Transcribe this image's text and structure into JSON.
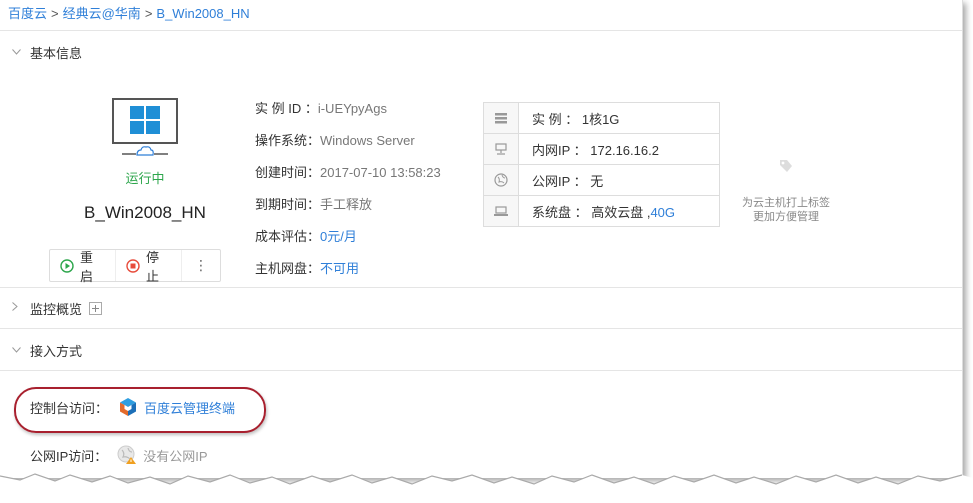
{
  "breadcrumb": {
    "items": [
      "百度云",
      "经典云@华南",
      "B_Win2008_HN"
    ],
    "separator": ">"
  },
  "sections": {
    "basic": "基本信息",
    "monitor": "监控概览",
    "access": "接入方式"
  },
  "instance": {
    "status": "运行中",
    "name": "B_Win2008_HN",
    "actions": {
      "restart": "重启",
      "stop": "停止",
      "more": "⋮"
    }
  },
  "info": [
    {
      "label": "实 例 ID ：",
      "value": "i-UEYpyAgs",
      "link": false
    },
    {
      "label": "操作系统：",
      "value": "Windows Server",
      "link": false
    },
    {
      "label": "创建时间：",
      "value": "2017-07-10 13:58:23",
      "link": false
    },
    {
      "label": "到期时间：",
      "value": "手工释放",
      "link": false
    },
    {
      "label": "成本评估：",
      "value": "0元/月",
      "link": true
    },
    {
      "label": "主机网盘：",
      "value": "不可用",
      "link": true
    }
  ],
  "specs": [
    {
      "icon": "server-icon",
      "text": "实 例 ： 1核1G",
      "extra": ""
    },
    {
      "icon": "lan-icon",
      "text": "内网IP ： 172.16.16.2",
      "extra": ""
    },
    {
      "icon": "globe-icon",
      "text": "公网IP ： 无",
      "extra": ""
    },
    {
      "icon": "disk-icon",
      "text": "系统盘 ： 高效云盘 ,",
      "extra": "40G"
    }
  ],
  "tag_tip": {
    "line1": "为云主机打上标签",
    "line2": "更加方便管理"
  },
  "access": {
    "console_label": "控制台访问：",
    "console_link": "百度云管理终端",
    "public_label": "公网IP访问：",
    "public_value": "没有公网IP"
  },
  "colors": {
    "link": "#2f7fd8",
    "running": "#2da64c",
    "highlight": "#a8202e"
  }
}
